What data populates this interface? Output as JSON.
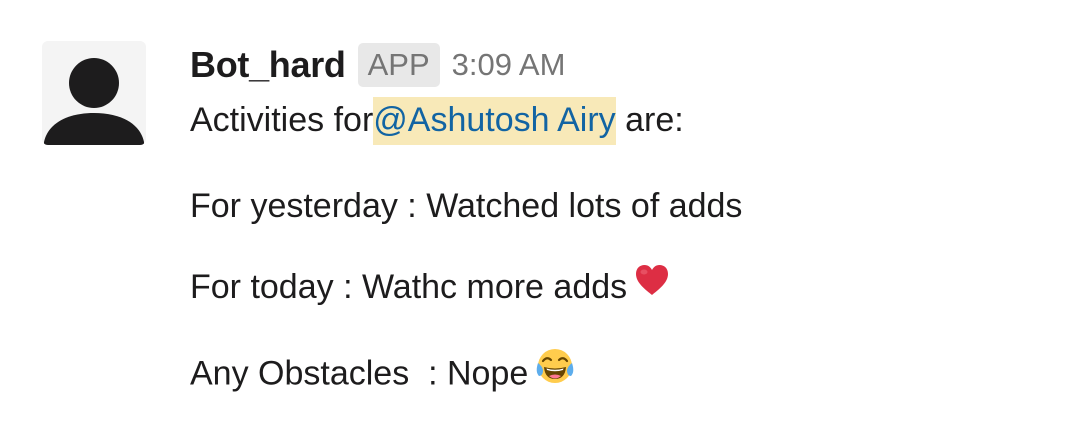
{
  "message": {
    "sender": "Bot_hard",
    "badge": "APP",
    "timestamp": "3:09 AM",
    "intro_prefix": "Activities for",
    "mention": "@Ashutosh Airy",
    "intro_suffix": " are:",
    "lines": [
      "For yesterday : Watched lots of adds",
      "For today : Wathc more adds",
      "Any Obstacles  : Nope"
    ],
    "emojis": [
      "heart-emoji",
      "tears-of-joy-emoji"
    ]
  },
  "colors": {
    "mention_text": "#1264a3",
    "mention_bg": "#f8e9b8",
    "timestamp": "#757575",
    "badge_bg": "#e8e8e8"
  },
  "icons": {
    "avatar": "user-silhouette-icon"
  }
}
